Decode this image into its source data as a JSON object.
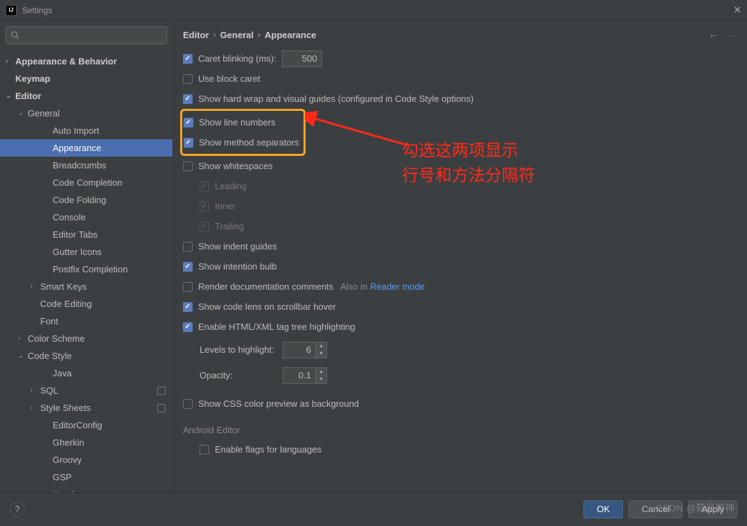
{
  "window": {
    "title": "Settings"
  },
  "search": {
    "placeholder": ""
  },
  "sidebar": {
    "items": [
      {
        "label": "Appearance & Behavior",
        "expand": "›",
        "bold": true,
        "indent": 0
      },
      {
        "label": "Keymap",
        "expand": "",
        "bold": true,
        "indent": 0
      },
      {
        "label": "Editor",
        "expand": "⌄",
        "bold": true,
        "indent": 0
      },
      {
        "label": "General",
        "expand": "⌄",
        "bold": false,
        "indent": 1
      },
      {
        "label": "Auto Import",
        "expand": "",
        "bold": false,
        "indent": 3
      },
      {
        "label": "Appearance",
        "expand": "",
        "bold": false,
        "indent": 3,
        "selected": true
      },
      {
        "label": "Breadcrumbs",
        "expand": "",
        "bold": false,
        "indent": 3
      },
      {
        "label": "Code Completion",
        "expand": "",
        "bold": false,
        "indent": 3
      },
      {
        "label": "Code Folding",
        "expand": "",
        "bold": false,
        "indent": 3
      },
      {
        "label": "Console",
        "expand": "",
        "bold": false,
        "indent": 3
      },
      {
        "label": "Editor Tabs",
        "expand": "",
        "bold": false,
        "indent": 3
      },
      {
        "label": "Gutter Icons",
        "expand": "",
        "bold": false,
        "indent": 3
      },
      {
        "label": "Postfix Completion",
        "expand": "",
        "bold": false,
        "indent": 3
      },
      {
        "label": "Smart Keys",
        "expand": "›",
        "bold": false,
        "indent": 2
      },
      {
        "label": "Code Editing",
        "expand": "",
        "bold": false,
        "indent": 2
      },
      {
        "label": "Font",
        "expand": "",
        "bold": false,
        "indent": 2
      },
      {
        "label": "Color Scheme",
        "expand": "›",
        "bold": false,
        "indent": 1
      },
      {
        "label": "Code Style",
        "expand": "⌄",
        "bold": false,
        "indent": 1
      },
      {
        "label": "Java",
        "expand": "",
        "bold": false,
        "indent": 3
      },
      {
        "label": "SQL",
        "expand": "›",
        "bold": false,
        "indent": 2,
        "badge": true
      },
      {
        "label": "Style Sheets",
        "expand": "›",
        "bold": false,
        "indent": 2,
        "badge": true
      },
      {
        "label": "EditorConfig",
        "expand": "",
        "bold": false,
        "indent": 3
      },
      {
        "label": "Gherkin",
        "expand": "",
        "bold": false,
        "indent": 3
      },
      {
        "label": "Groovy",
        "expand": "",
        "bold": false,
        "indent": 3
      },
      {
        "label": "GSP",
        "expand": "",
        "bold": false,
        "indent": 3
      },
      {
        "label": "Haml",
        "expand": "",
        "bold": false,
        "indent": 3
      }
    ]
  },
  "breadcrumb": {
    "p0": "Editor",
    "p1": "General",
    "p2": "Appearance"
  },
  "options": {
    "caret_blinking": "Caret blinking (ms):",
    "caret_blinking_val": "500",
    "use_block_caret": "Use block caret",
    "show_hard_wrap": "Show hard wrap and visual guides (configured in Code Style options)",
    "show_line_numbers": "Show line numbers",
    "show_method_separators": "Show method separators",
    "show_whitespaces": "Show whitespaces",
    "leading": "Leading",
    "inner": "Inner",
    "trailing": "Trailing",
    "show_indent_guides": "Show indent guides",
    "show_intention_bulb": "Show intention bulb",
    "render_doc": "Render documentation comments",
    "also_in": "Also in",
    "reader_mode": "Reader mode",
    "show_code_lens": "Show code lens on scrollbar hover",
    "enable_html_xml": "Enable HTML/XML tag tree highlighting",
    "levels_label": "Levels to highlight:",
    "levels_val": "6",
    "opacity_label": "Opacity:",
    "opacity_val": "0.1",
    "show_css_preview": "Show CSS color preview as background",
    "android_editor": "Android Editor",
    "enable_flags": "Enable flags for languages"
  },
  "annotation": {
    "line1": "勾选这两项显示",
    "line2": "行号和方法分隔符"
  },
  "footer": {
    "ok": "OK",
    "cancel": "Cancel",
    "apply": "Apply"
  },
  "watermark": "CSDN @莪是男神"
}
